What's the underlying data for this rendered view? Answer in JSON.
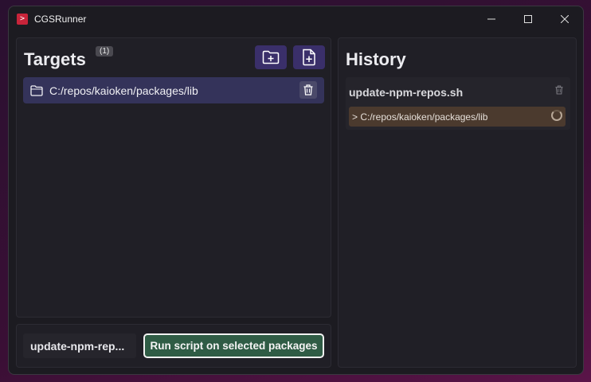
{
  "window": {
    "title": "CGSRunner",
    "app_icon": "terminal-icon",
    "controls": [
      "minimize-icon",
      "maximize-icon",
      "close-icon"
    ]
  },
  "targets": {
    "title": "Targets",
    "count_badge": "(1)",
    "add_folder_icon": "folder-plus-icon",
    "add_file_icon": "file-plus-icon",
    "items": [
      {
        "icon": "folder-icon",
        "path": "C:/repos/kaioken/packages/lib",
        "remove_icon": "trash-icon"
      }
    ]
  },
  "actions": {
    "script_select_value": "update-npm-rep...",
    "run_button_label": "Run script on selected packages"
  },
  "history": {
    "title": "History",
    "groups": [
      {
        "script": "update-npm-repos.sh",
        "remove_icon": "trash-icon",
        "runs": [
          {
            "path": "> C:/repos/kaioken/packages/lib",
            "status_icon": "loading-spinner-icon"
          }
        ]
      }
    ]
  },
  "colors": {
    "accent_button": "#3a2f6a",
    "selected_row": "#34335a",
    "run_button": "#2f5c45",
    "running_item": "#4b3a2e"
  }
}
